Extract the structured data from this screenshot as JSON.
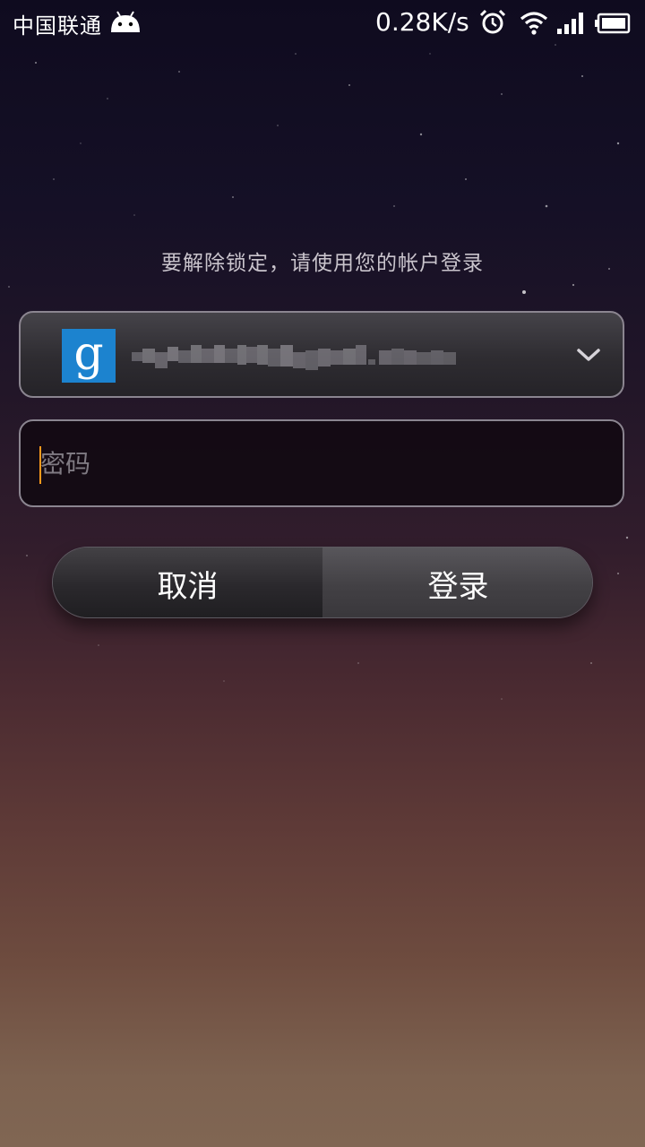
{
  "status_bar": {
    "carrier": "中国联通",
    "net_speed": "0.28K/s",
    "icons": [
      "android-icon",
      "alarm-icon",
      "wifi-icon",
      "signal-icon",
      "battery-icon"
    ]
  },
  "unlock": {
    "prompt": "要解除锁定，请使用您的帐户登录",
    "account": {
      "logo_letter": "g",
      "email": "zyf2011@gmail.com",
      "email_blurred": true,
      "brand_color": "#1c83cf"
    },
    "password_placeholder": "密码",
    "password_value": "",
    "cancel_label": "取消",
    "login_label": "登录"
  }
}
